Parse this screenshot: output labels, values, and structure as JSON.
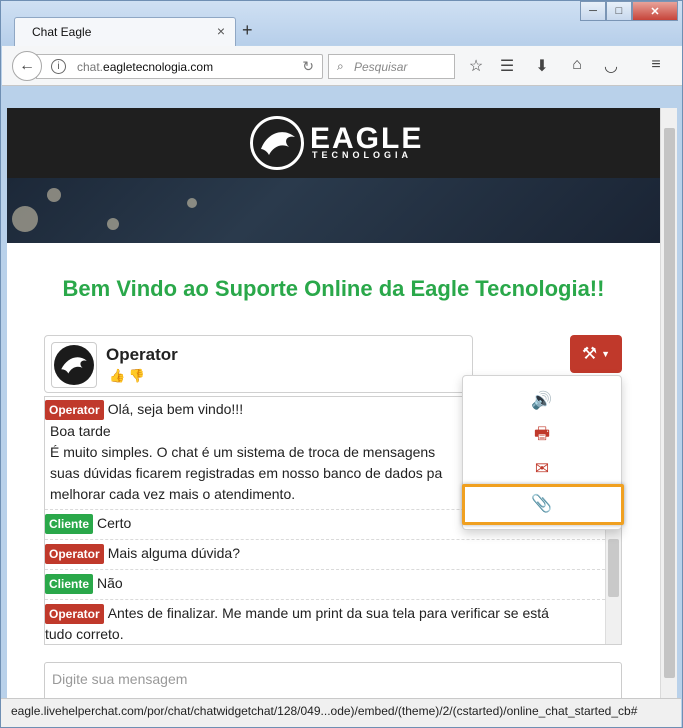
{
  "browser": {
    "tab_title": "Chat Eagle",
    "tab_close": "×",
    "new_tab": "+",
    "window_buttons": [
      "─",
      "□",
      "✕"
    ],
    "url_prefix": "chat.",
    "url_domain": "eagletecnologia.com",
    "search_placeholder": "Pesquisar",
    "status_url": "eagle.livehelperchat.com/por/chat/chatwidgetchat/128/049...ode)/embed/(theme)/2/(cstarted)/online_chat_started_cb#"
  },
  "header": {
    "logo_main": "EAGLE",
    "logo_sub": "TECNOLOGIA"
  },
  "page": {
    "welcome": "Bem Vindo ao Suporte Online da Eagle Tecnologia!!",
    "operator_name": "Operator",
    "input_placeholder": "Digite sua mensagem"
  },
  "messages": [
    {
      "role": "Operator",
      "text": "Olá, seja bem vindo!!!"
    },
    {
      "role": "",
      "text": "Boa tarde"
    },
    {
      "role": "",
      "text": "É muito simples. O chat é um sistema de troca de mensagens"
    },
    {
      "role": "",
      "text": "suas dúvidas ficarem registradas em nosso banco de dados pa"
    },
    {
      "role": "",
      "text": "melhorar cada vez mais o atendimento."
    },
    {
      "role": "Cliente",
      "text": "Certo"
    },
    {
      "role": "Operator",
      "text": "Mais alguma dúvida?"
    },
    {
      "role": "Cliente",
      "text": "Não"
    },
    {
      "role": "Operator",
      "text": "Antes de finalizar. Me mande um print da sua tela para verificar se está"
    },
    {
      "role": "",
      "text": "tudo correto."
    }
  ],
  "dropdown": {
    "items": [
      "sound-icon",
      "print-icon",
      "mail-icon",
      "paperclip-icon"
    ]
  },
  "colors": {
    "accent_red": "#c0392b",
    "accent_green": "#2aa84a",
    "highlight": "#f0a020"
  }
}
